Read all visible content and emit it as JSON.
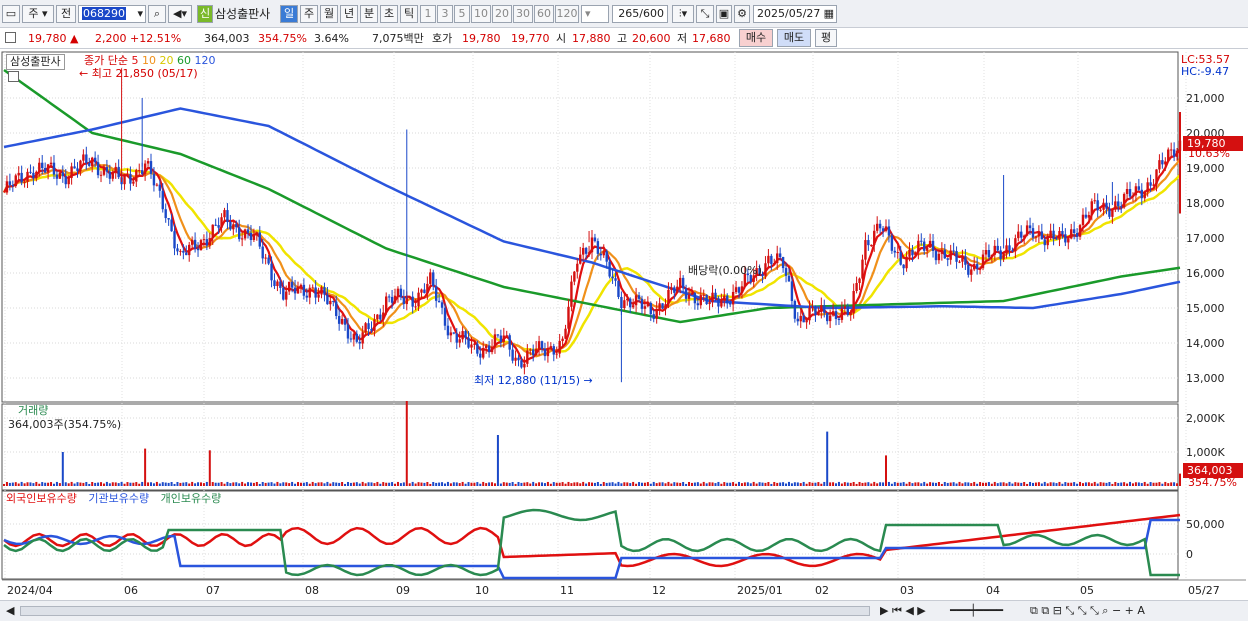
{
  "toolbar": {
    "market": "주",
    "prev": "전",
    "code": "068290",
    "name": "삼성출판사",
    "shin": "신",
    "tabs": [
      "일",
      "주",
      "월",
      "년",
      "분",
      "초",
      "틱"
    ],
    "nums": [
      "1",
      "3",
      "5",
      "10",
      "20",
      "30",
      "60",
      "120"
    ],
    "count": "265",
    "count_total": "/600",
    "date": "2025/05/27"
  },
  "quote": {
    "price": "19,780",
    "arrow": "▲",
    "change": "2,200",
    "change_pct": "+12.51%",
    "volume": "364,003",
    "vol_pct": "354.75%",
    "turnover": "3.64%",
    "amount": "7,075백만",
    "ask_label": "호가",
    "ask": "19,780",
    "bid": "19,770",
    "open_label": "시",
    "open": "17,880",
    "high_label": "고",
    "high": "20,600",
    "low_label": "저",
    "low": "17,680",
    "buy": "매수",
    "sell": "매도",
    "avg": "평"
  },
  "chart_labels": {
    "stock": "삼성출판사",
    "price_legend": "종가 단순",
    "ma_periods": [
      "5",
      "10",
      "20",
      "60",
      "120"
    ],
    "lc": "LC:53.57",
    "hc": "HC:-9.47",
    "max_label": "최고 21,850 (05/17)",
    "min_label": "최저 12,880 (11/15)",
    "dividend": "배당락(0.00%)",
    "volume_title": "거래량",
    "volume_value": "364,003주(354.75%)",
    "flow_titles": [
      "외국인보유수량",
      "기관보유수량",
      "개인보유수량"
    ],
    "price_tag": "19,780",
    "price_tag_pct": "10.63%",
    "vol_tag": "364,003",
    "vol_tag_pct": "354.75%"
  },
  "colors": {
    "ma5": "#e01010",
    "ma10": "#f0901a",
    "ma20": "#f0e400",
    "ma60": "#1a9a2a",
    "ma120": "#2a55dd",
    "up": "#d41010",
    "down": "#1a48c8",
    "foreign": "#e01010",
    "inst": "#2a55dd",
    "indiv": "#2a8a50"
  },
  "chart_data": {
    "type": "candlestick",
    "y_ticks": [
      "21,000",
      "20,000",
      "19,000",
      "18,000",
      "17,000",
      "16,000",
      "15,000",
      "14,000",
      "13,000"
    ],
    "volume_ticks": [
      "2,000K",
      "1,000K"
    ],
    "flow_ticks": [
      "50,000",
      "0"
    ],
    "x_labels": [
      "2024/04",
      "06",
      "07",
      "08",
      "09",
      "10",
      "11",
      "12",
      "2025/01",
      "02",
      "03",
      "04",
      "05",
      "05/27"
    ],
    "ylim": [
      12600,
      21900
    ],
    "high": 21850,
    "low": 12880,
    "last": 19780,
    "ma120_anchor": [
      [
        0,
        19600
      ],
      [
        30,
        20100
      ],
      [
        60,
        20700
      ],
      [
        90,
        20200
      ],
      [
        130,
        18500
      ],
      [
        170,
        16900
      ],
      [
        200,
        16300
      ],
      [
        240,
        15200
      ],
      [
        280,
        15000
      ],
      [
        320,
        15050
      ],
      [
        350,
        15000
      ],
      [
        380,
        15400
      ],
      [
        400,
        15750
      ]
    ],
    "ma60_anchor": [
      [
        0,
        21800
      ],
      [
        30,
        20000
      ],
      [
        60,
        19400
      ],
      [
        90,
        18400
      ],
      [
        130,
        16700
      ],
      [
        170,
        15600
      ],
      [
        200,
        15100
      ],
      [
        230,
        14600
      ],
      [
        260,
        15000
      ],
      [
        300,
        15100
      ],
      [
        340,
        15200
      ],
      [
        380,
        15900
      ],
      [
        400,
        16150
      ]
    ],
    "price_anchor": [
      [
        0,
        18300
      ],
      [
        10,
        19000
      ],
      [
        20,
        18800
      ],
      [
        30,
        19200
      ],
      [
        40,
        18600
      ],
      [
        48,
        19100
      ],
      [
        55,
        17800
      ],
      [
        60,
        16400
      ],
      [
        68,
        17000
      ],
      [
        75,
        17500
      ],
      [
        85,
        17000
      ],
      [
        95,
        15400
      ],
      [
        105,
        15600
      ],
      [
        115,
        14700
      ],
      [
        120,
        13900
      ],
      [
        130,
        15200
      ],
      [
        140,
        15300
      ],
      [
        145,
        15700
      ],
      [
        152,
        14300
      ],
      [
        160,
        13800
      ],
      [
        170,
        14100
      ],
      [
        175,
        13500
      ],
      [
        180,
        13700
      ],
      [
        190,
        14000
      ],
      [
        195,
        16400
      ],
      [
        200,
        17000
      ],
      [
        210,
        15300
      ],
      [
        220,
        14900
      ],
      [
        230,
        15600
      ],
      [
        240,
        15100
      ],
      [
        250,
        15500
      ],
      [
        260,
        16400
      ],
      [
        265,
        16200
      ],
      [
        270,
        14700
      ],
      [
        280,
        14900
      ],
      [
        288,
        14800
      ],
      [
        293,
        16900
      ],
      [
        298,
        17300
      ],
      [
        305,
        16400
      ],
      [
        315,
        16800
      ],
      [
        322,
        16400
      ],
      [
        330,
        16200
      ],
      [
        340,
        16700
      ],
      [
        350,
        17200
      ],
      [
        360,
        16900
      ],
      [
        370,
        17800
      ],
      [
        380,
        18000
      ],
      [
        390,
        18600
      ],
      [
        400,
        19780
      ]
    ],
    "volume_spikes": [
      [
        20,
        1000
      ],
      [
        48,
        1100
      ],
      [
        70,
        1050
      ],
      [
        137,
        2500
      ],
      [
        168,
        1500
      ],
      [
        280,
        1600
      ],
      [
        300,
        900
      ]
    ],
    "series": [
      {
        "name": "외국인보유수량"
      },
      {
        "name": "기관보유수량"
      },
      {
        "name": "개인보유수량"
      }
    ]
  }
}
